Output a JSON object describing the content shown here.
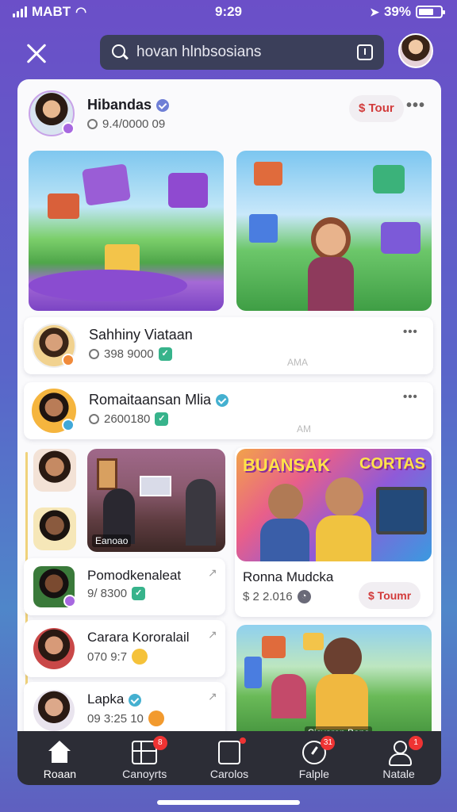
{
  "status": {
    "carrier": "MABT",
    "time": "9:29",
    "battery": "39%"
  },
  "search": {
    "query": "hovan hlnbsosians"
  },
  "profile": {
    "name": "Hibandas",
    "meta": "9.4/0000 09",
    "action": "$ Tour"
  },
  "tiles": {
    "lounge_caption": "Eanoao"
  },
  "rows": [
    {
      "name": "Sahhiny Viataan",
      "meta": "398 9000",
      "time": "AMA"
    },
    {
      "name": "Romaitaansan Mlia",
      "meta": "2600180",
      "time": "AM"
    }
  ],
  "list": [
    {
      "name": "Pomodkenaleat",
      "meta": "9/ 8300"
    },
    {
      "name": "Carara Kororalail",
      "meta": "070 9:7"
    },
    {
      "name": "Lapka",
      "meta": "09 3:25 10"
    }
  ],
  "feature": {
    "banner_left": "BUANSAK",
    "banner_right": "CORTAS",
    "name": "Ronna Mudcka",
    "meta": "$ 2 2.016",
    "action": "$ Toumr"
  },
  "bottom_tile": {
    "caption": "Sicvaron Bans"
  },
  "nav": [
    {
      "label": "Roaan",
      "badge": ""
    },
    {
      "label": "Canoyrts",
      "badge": "8"
    },
    {
      "label": "Carolos",
      "badge": ""
    },
    {
      "label": "Falple",
      "badge": "31"
    },
    {
      "label": "Natale",
      "badge": "1"
    }
  ],
  "colors": {
    "accent": "#6b4fc8",
    "nav_bg": "#2c2d36",
    "alert": "#e33333"
  }
}
